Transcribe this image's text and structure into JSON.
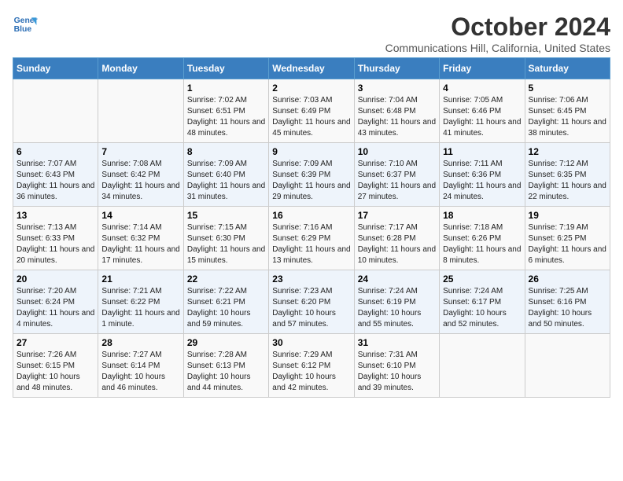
{
  "header": {
    "logo_line1": "General",
    "logo_line2": "Blue",
    "title": "October 2024",
    "subtitle": "Communications Hill, California, United States"
  },
  "days_of_week": [
    "Sunday",
    "Monday",
    "Tuesday",
    "Wednesday",
    "Thursday",
    "Friday",
    "Saturday"
  ],
  "weeks": [
    [
      {
        "day": "",
        "info": ""
      },
      {
        "day": "",
        "info": ""
      },
      {
        "day": "1",
        "info": "Sunrise: 7:02 AM\nSunset: 6:51 PM\nDaylight: 11 hours and 48 minutes."
      },
      {
        "day": "2",
        "info": "Sunrise: 7:03 AM\nSunset: 6:49 PM\nDaylight: 11 hours and 45 minutes."
      },
      {
        "day": "3",
        "info": "Sunrise: 7:04 AM\nSunset: 6:48 PM\nDaylight: 11 hours and 43 minutes."
      },
      {
        "day": "4",
        "info": "Sunrise: 7:05 AM\nSunset: 6:46 PM\nDaylight: 11 hours and 41 minutes."
      },
      {
        "day": "5",
        "info": "Sunrise: 7:06 AM\nSunset: 6:45 PM\nDaylight: 11 hours and 38 minutes."
      }
    ],
    [
      {
        "day": "6",
        "info": "Sunrise: 7:07 AM\nSunset: 6:43 PM\nDaylight: 11 hours and 36 minutes."
      },
      {
        "day": "7",
        "info": "Sunrise: 7:08 AM\nSunset: 6:42 PM\nDaylight: 11 hours and 34 minutes."
      },
      {
        "day": "8",
        "info": "Sunrise: 7:09 AM\nSunset: 6:40 PM\nDaylight: 11 hours and 31 minutes."
      },
      {
        "day": "9",
        "info": "Sunrise: 7:09 AM\nSunset: 6:39 PM\nDaylight: 11 hours and 29 minutes."
      },
      {
        "day": "10",
        "info": "Sunrise: 7:10 AM\nSunset: 6:37 PM\nDaylight: 11 hours and 27 minutes."
      },
      {
        "day": "11",
        "info": "Sunrise: 7:11 AM\nSunset: 6:36 PM\nDaylight: 11 hours and 24 minutes."
      },
      {
        "day": "12",
        "info": "Sunrise: 7:12 AM\nSunset: 6:35 PM\nDaylight: 11 hours and 22 minutes."
      }
    ],
    [
      {
        "day": "13",
        "info": "Sunrise: 7:13 AM\nSunset: 6:33 PM\nDaylight: 11 hours and 20 minutes."
      },
      {
        "day": "14",
        "info": "Sunrise: 7:14 AM\nSunset: 6:32 PM\nDaylight: 11 hours and 17 minutes."
      },
      {
        "day": "15",
        "info": "Sunrise: 7:15 AM\nSunset: 6:30 PM\nDaylight: 11 hours and 15 minutes."
      },
      {
        "day": "16",
        "info": "Sunrise: 7:16 AM\nSunset: 6:29 PM\nDaylight: 11 hours and 13 minutes."
      },
      {
        "day": "17",
        "info": "Sunrise: 7:17 AM\nSunset: 6:28 PM\nDaylight: 11 hours and 10 minutes."
      },
      {
        "day": "18",
        "info": "Sunrise: 7:18 AM\nSunset: 6:26 PM\nDaylight: 11 hours and 8 minutes."
      },
      {
        "day": "19",
        "info": "Sunrise: 7:19 AM\nSunset: 6:25 PM\nDaylight: 11 hours and 6 minutes."
      }
    ],
    [
      {
        "day": "20",
        "info": "Sunrise: 7:20 AM\nSunset: 6:24 PM\nDaylight: 11 hours and 4 minutes."
      },
      {
        "day": "21",
        "info": "Sunrise: 7:21 AM\nSunset: 6:22 PM\nDaylight: 11 hours and 1 minute."
      },
      {
        "day": "22",
        "info": "Sunrise: 7:22 AM\nSunset: 6:21 PM\nDaylight: 10 hours and 59 minutes."
      },
      {
        "day": "23",
        "info": "Sunrise: 7:23 AM\nSunset: 6:20 PM\nDaylight: 10 hours and 57 minutes."
      },
      {
        "day": "24",
        "info": "Sunrise: 7:24 AM\nSunset: 6:19 PM\nDaylight: 10 hours and 55 minutes."
      },
      {
        "day": "25",
        "info": "Sunrise: 7:24 AM\nSunset: 6:17 PM\nDaylight: 10 hours and 52 minutes."
      },
      {
        "day": "26",
        "info": "Sunrise: 7:25 AM\nSunset: 6:16 PM\nDaylight: 10 hours and 50 minutes."
      }
    ],
    [
      {
        "day": "27",
        "info": "Sunrise: 7:26 AM\nSunset: 6:15 PM\nDaylight: 10 hours and 48 minutes."
      },
      {
        "day": "28",
        "info": "Sunrise: 7:27 AM\nSunset: 6:14 PM\nDaylight: 10 hours and 46 minutes."
      },
      {
        "day": "29",
        "info": "Sunrise: 7:28 AM\nSunset: 6:13 PM\nDaylight: 10 hours and 44 minutes."
      },
      {
        "day": "30",
        "info": "Sunrise: 7:29 AM\nSunset: 6:12 PM\nDaylight: 10 hours and 42 minutes."
      },
      {
        "day": "31",
        "info": "Sunrise: 7:31 AM\nSunset: 6:10 PM\nDaylight: 10 hours and 39 minutes."
      },
      {
        "day": "",
        "info": ""
      },
      {
        "day": "",
        "info": ""
      }
    ]
  ]
}
